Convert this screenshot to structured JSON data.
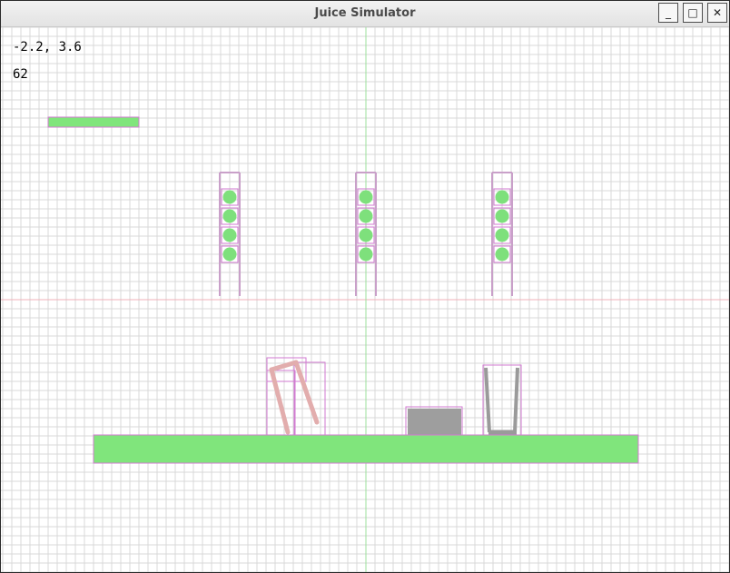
{
  "window": {
    "title": "Juice Simulator",
    "controls": {
      "minimize": "_",
      "maximize": "□",
      "close": "✕"
    }
  },
  "hud": {
    "cursor_coords": "-2.2, 3.6",
    "counter": "62"
  },
  "colors": {
    "grid_line": "#d8d8d8",
    "axis_x": "#f0b0b8",
    "axis_y": "#9de09d",
    "static_green": "#80e57c",
    "bounding_box": "#d27ad2",
    "dispenser_frame": "#c9a0c9",
    "juice_ball": "#7ee07c",
    "cup_wall": "#9a9a9a",
    "box": "#9e9e9e",
    "stand_pink": "#e2adad"
  }
}
